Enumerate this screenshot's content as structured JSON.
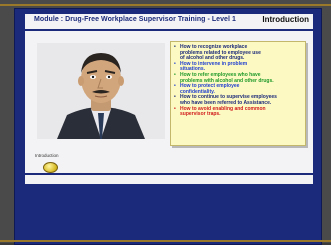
{
  "header": {
    "course_title": "Module : Drug-Free Workplace Supervisor Training - Level 1",
    "section_title": "Introduction"
  },
  "objectives": [
    {
      "text": "How to recognize workplace",
      "color": "#1b2a7a",
      "bullet": "•"
    },
    {
      "text": "problems related to employee use",
      "color": "#1b2a7a",
      "bullet": ""
    },
    {
      "text": "of alcohol and other drugs.",
      "color": "#1b2a7a",
      "bullet": ""
    },
    {
      "text": "How to intervene in problem",
      "color": "#1f3fd0",
      "bullet": "•"
    },
    {
      "text": "situations.",
      "color": "#1f3fd0",
      "bullet": ""
    },
    {
      "text": "How to refer employees who have",
      "color": "#1f9a2a",
      "bullet": "•"
    },
    {
      "text": "problems with alcohol and other drugs.",
      "color": "#1f9a2a",
      "bullet": ""
    },
    {
      "text": "How to protect employee",
      "color": "#1f3fd0",
      "bullet": "•"
    },
    {
      "text": "confidentiality.",
      "color": "#1f3fd0",
      "bullet": ""
    },
    {
      "text": "How to continue to supervise employees",
      "color": "#1b2a7a",
      "bullet": "•"
    },
    {
      "text": "who have been referred to Assistance.",
      "color": "#1b2a7a",
      "bullet": ""
    },
    {
      "text": "How to avoid enabling and common",
      "color": "#d01a1a",
      "bullet": "•"
    },
    {
      "text": "supervisor traps.",
      "color": "#d01a1a",
      "bullet": ""
    }
  ],
  "nav": {
    "intro_label": "Introduction"
  }
}
